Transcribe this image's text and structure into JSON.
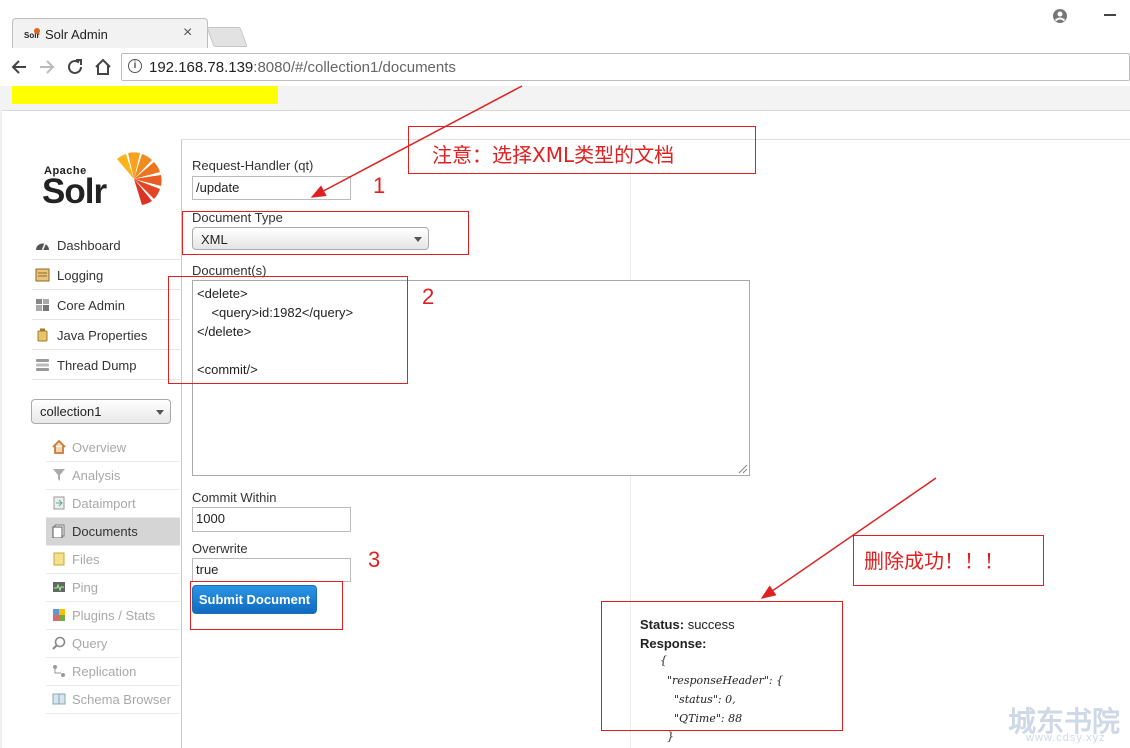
{
  "browser": {
    "tab_title": "Solr Admin",
    "tab_close": "×",
    "url_host": "192.168.78.139",
    "url_rest": ":8080/#/collection1/documents"
  },
  "logo": {
    "apache": "Apache",
    "solr": "Solr"
  },
  "sidebar": {
    "items": [
      {
        "label": "Dashboard",
        "icon": "dashboard-icon"
      },
      {
        "label": "Logging",
        "icon": "logging-icon"
      },
      {
        "label": "Core Admin",
        "icon": "core-admin-icon"
      },
      {
        "label": "Java Properties",
        "icon": "java-properties-icon"
      },
      {
        "label": "Thread Dump",
        "icon": "thread-dump-icon"
      }
    ],
    "core_selector": "collection1",
    "core_menu": [
      {
        "label": "Overview",
        "icon": "home-icon"
      },
      {
        "label": "Analysis",
        "icon": "filter-icon"
      },
      {
        "label": "Dataimport",
        "icon": "import-icon"
      },
      {
        "label": "Documents",
        "icon": "documents-icon",
        "active": true
      },
      {
        "label": "Files",
        "icon": "files-icon"
      },
      {
        "label": "Ping",
        "icon": "ping-icon"
      },
      {
        "label": "Plugins / Stats",
        "icon": "plugins-icon"
      },
      {
        "label": "Query",
        "icon": "query-icon"
      },
      {
        "label": "Replication",
        "icon": "replication-icon"
      },
      {
        "label": "Schema Browser",
        "icon": "schema-icon"
      }
    ]
  },
  "form": {
    "handler_label": "Request-Handler (qt)",
    "handler_value": "/update",
    "doctype_label": "Document Type",
    "doctype_value": "XML",
    "documents_label": "Document(s)",
    "documents_lines": [
      "<delete>",
      "    <query>id:1982</query>",
      "</delete>",
      "",
      "<commit/>"
    ],
    "commit_within_label": "Commit Within",
    "commit_within_value": "1000",
    "overwrite_label": "Overwrite",
    "overwrite_value": "true",
    "submit_label": "Submit Document"
  },
  "response": {
    "status_label": "Status:",
    "status_value": "success",
    "response_label": "Response:",
    "lines": [
      "{",
      "  \"responseHeader\": {",
      "    \"status\": 0,",
      "    \"QTime\": 88",
      "  }"
    ]
  },
  "annotations": {
    "note": "注意：选择XML类型的文档",
    "num1": "1",
    "num2": "2",
    "num3": "3",
    "success": "删除成功！！！",
    "accent_color": "#e02020"
  },
  "watermark": {
    "text": "城东书院",
    "url": "www.cdsy.xyz"
  }
}
